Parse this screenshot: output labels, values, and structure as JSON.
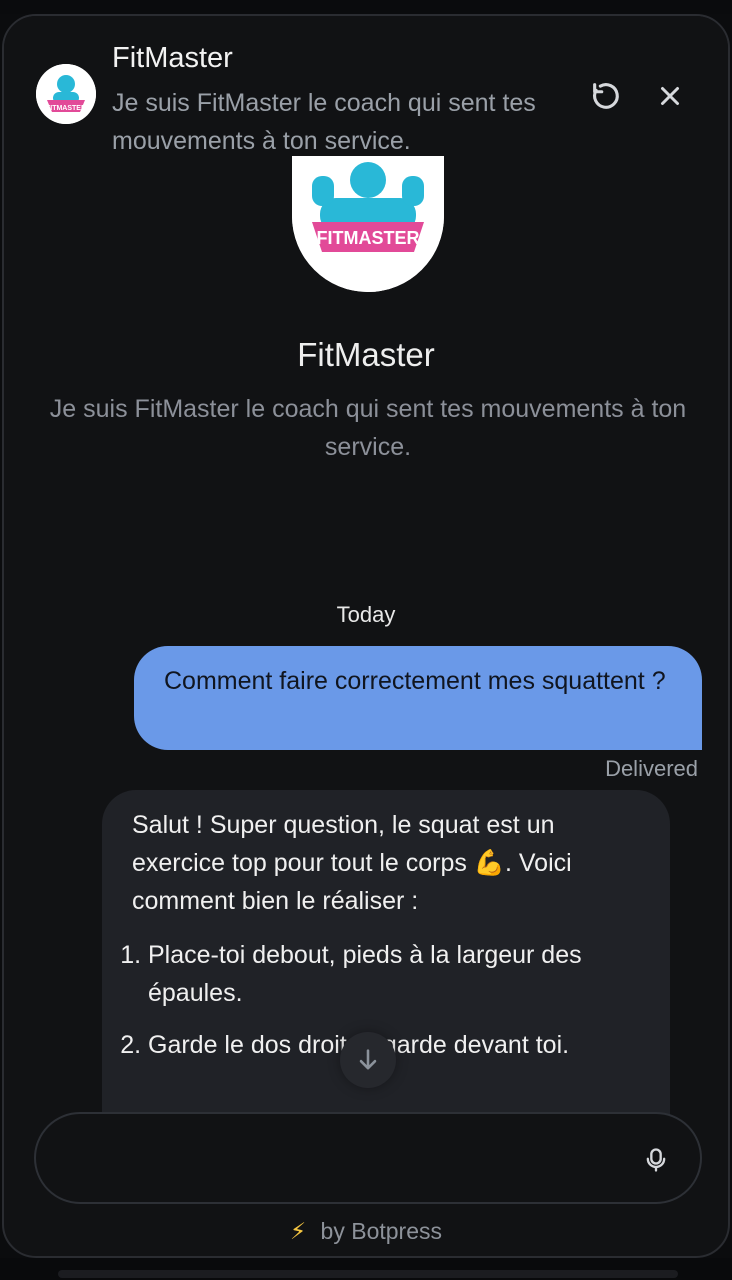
{
  "header": {
    "title": "FitMaster",
    "subtitle": "Je suis FitMaster le coach qui sent tes mouvements à ton service."
  },
  "hero": {
    "title": "FitMaster",
    "subtitle": "Je suis FitMaster le coach qui sent tes mouvements à ton service."
  },
  "conversation": {
    "date_label": "Today",
    "user_message": "Comment faire correctement mes squattent ?",
    "user_status": "Delivered",
    "bot_message_intro": "Salut ! Super question, le squat est un exercice top pour tout le corps 💪. Voici comment bien le réaliser :",
    "bot_steps": [
      "Place-toi debout, pieds à la largeur des épaules.",
      "Garde le dos droit, regarde devant toi."
    ]
  },
  "composer": {
    "value": "",
    "placeholder": ""
  },
  "footer": {
    "text": "by Botpress"
  },
  "icons": {
    "restart": "restart-icon",
    "close": "close-icon",
    "scroll": "arrow-down-icon",
    "mic": "mic-icon",
    "bolt": "bolt-icon"
  },
  "colors": {
    "background": "#111214",
    "user_bubble": "#6a99e8",
    "bot_bubble": "#202227",
    "brand_pink": "#e24a98",
    "brand_cyan": "#29b8d7"
  }
}
